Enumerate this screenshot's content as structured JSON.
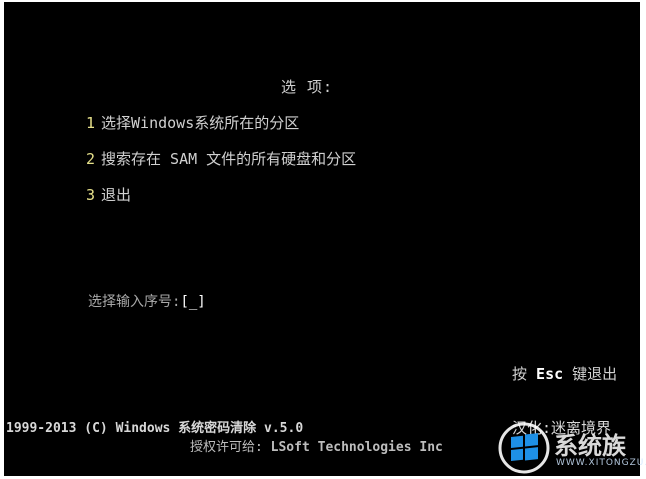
{
  "menu": {
    "title": "选 项:",
    "items": [
      {
        "number": "1",
        "label": "选择Windows系统所在的分区"
      },
      {
        "number": "2",
        "label": "搜索存在 SAM 文件的所有硬盘和分区"
      },
      {
        "number": "3",
        "label": "退出"
      }
    ]
  },
  "prompt": {
    "label": "选择输入序号:",
    "input_value": "[_]"
  },
  "esc_hint": {
    "prefix": "按",
    "key": "Esc",
    "suffix": "键退出"
  },
  "footer": {
    "product": "1999-2013 (C)  Windows 系统密码清除 v.5.0",
    "license_label": "授权许可给:",
    "license_company": "LSoft Technologies Inc",
    "localizer": "汉化:迷离境界"
  },
  "watermark": {
    "brand_text": "系统族",
    "site_text": "WWW.XITONGZU.COM",
    "logo_icon": "windows-logo-icon",
    "logo_color": "#1e90e6"
  },
  "colors": {
    "background": "#000000",
    "text": "#d0d0d0",
    "number_accent": "#e6e08a"
  }
}
